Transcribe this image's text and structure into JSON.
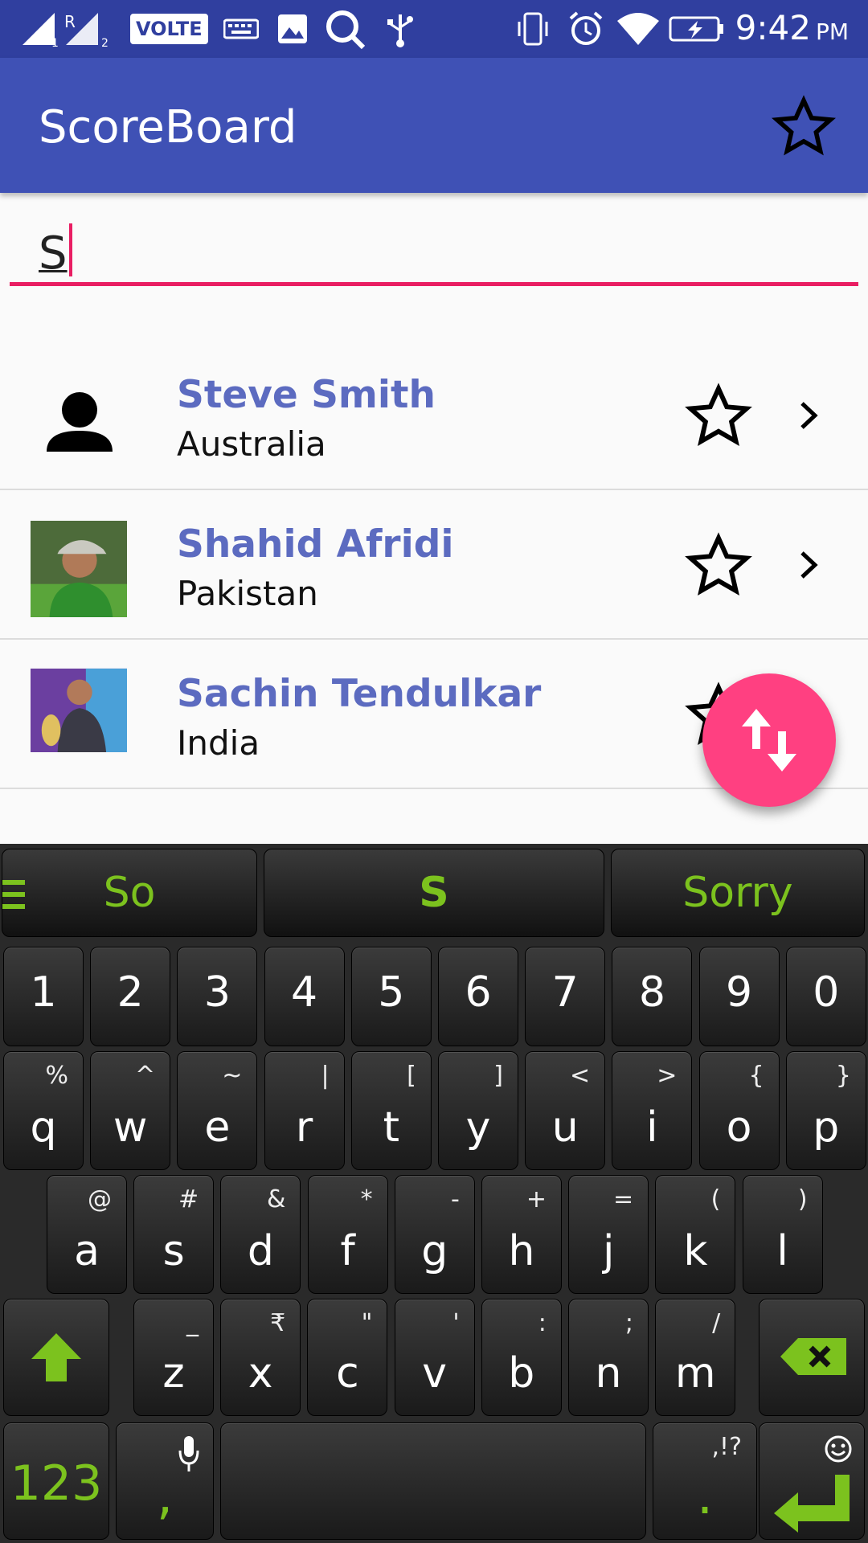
{
  "status_bar": {
    "volte": "VOLTE",
    "time": "9:42",
    "ampm": "PM",
    "sim1_label": "R",
    "icons": [
      "signal-sim1-icon",
      "signal-sim2-icon",
      "volte-icon",
      "keyboard-icon",
      "image-icon",
      "search-icon",
      "usb-icon",
      "vibrate-icon",
      "alarm-icon",
      "wifi-icon",
      "battery-charging-icon"
    ]
  },
  "app_bar": {
    "title": "ScoreBoard",
    "favorites_icon": "star-outline-icon"
  },
  "search": {
    "value": "S"
  },
  "players": [
    {
      "name": "Steve Smith",
      "country": "Australia",
      "avatar": "person-placeholder-icon"
    },
    {
      "name": "Shahid Afridi",
      "country": "Pakistan",
      "avatar": "player-photo"
    },
    {
      "name": "Sachin Tendulkar",
      "country": "India",
      "avatar": "player-photo"
    }
  ],
  "fab": {
    "icon": "swap-vertical-icon"
  },
  "colors": {
    "status_bar": "#303f9f",
    "primary": "#3f51b5",
    "accent": "#ff4081",
    "name_text": "#5c6bc0",
    "keyboard_green": "#7cc21e"
  },
  "keyboard": {
    "suggestions": [
      "So",
      "S",
      "Sorry"
    ],
    "number_row": [
      "1",
      "2",
      "3",
      "4",
      "5",
      "6",
      "7",
      "8",
      "9",
      "0"
    ],
    "row1": [
      {
        "k": "q",
        "a": "%"
      },
      {
        "k": "w",
        "a": "^"
      },
      {
        "k": "e",
        "a": "~"
      },
      {
        "k": "r",
        "a": "|"
      },
      {
        "k": "t",
        "a": "["
      },
      {
        "k": "y",
        "a": "]"
      },
      {
        "k": "u",
        "a": "<"
      },
      {
        "k": "i",
        "a": ">"
      },
      {
        "k": "o",
        "a": "{"
      },
      {
        "k": "p",
        "a": "}"
      }
    ],
    "row2": [
      {
        "k": "a",
        "a": "@"
      },
      {
        "k": "s",
        "a": "#"
      },
      {
        "k": "d",
        "a": "&"
      },
      {
        "k": "f",
        "a": "*"
      },
      {
        "k": "g",
        "a": "-"
      },
      {
        "k": "h",
        "a": "+"
      },
      {
        "k": "j",
        "a": "="
      },
      {
        "k": "k",
        "a": "("
      },
      {
        "k": "l",
        "a": ")"
      }
    ],
    "row3": [
      {
        "k": "z",
        "a": "_"
      },
      {
        "k": "x",
        "a": "₹"
      },
      {
        "k": "c",
        "a": "\""
      },
      {
        "k": "v",
        "a": "'"
      },
      {
        "k": "b",
        "a": ":"
      },
      {
        "k": "n",
        "a": ";"
      },
      {
        "k": "m",
        "a": "/"
      }
    ],
    "bottom": {
      "symbols_label": "123",
      "comma": ",",
      "period": ".",
      "period_alt": ",!?"
    }
  }
}
